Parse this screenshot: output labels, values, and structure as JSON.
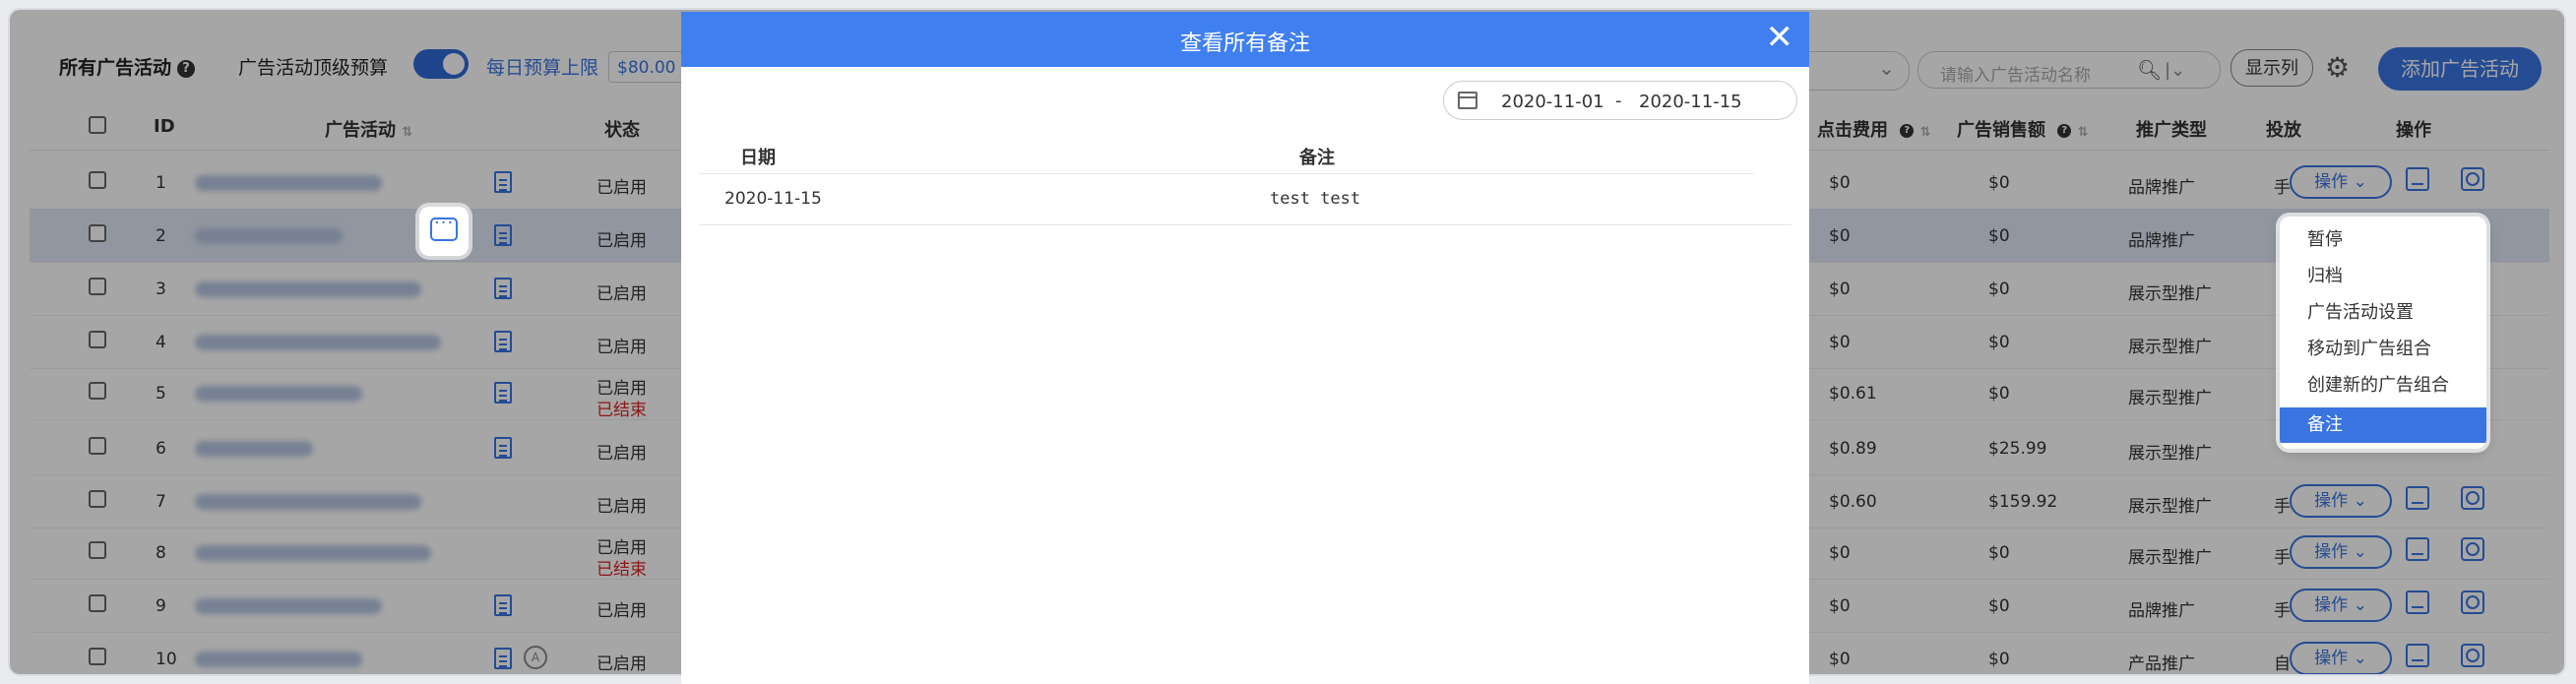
{
  "toolbar": {
    "all_campaigns": "所有广告活动",
    "top_budget_label": "广告活动顶级预算",
    "daily_budget_link": "每日预算上限",
    "budget_value": "$80.00",
    "search_placeholder": "请输入广告活动名称",
    "columns_button": "显示列",
    "add_button": "添加广告活动"
  },
  "table": {
    "headers": {
      "id": "ID",
      "campaign": "广告活动",
      "status": "状态",
      "cpc": "点击费用",
      "sales": "广告销售额",
      "promo_type": "推广类型",
      "delivery": "投放",
      "actions": "操作"
    },
    "rows": [
      {
        "id": "1",
        "status": "已启用",
        "status2": "",
        "cpc": "$0",
        "sales": "$0",
        "type": "品牌推广",
        "delivery": "手",
        "op": "操作"
      },
      {
        "id": "2",
        "status": "已启用",
        "status2": "",
        "cpc": "$0",
        "sales": "$0",
        "type": "品牌推广",
        "delivery": "",
        "op": ""
      },
      {
        "id": "3",
        "status": "已启用",
        "status2": "",
        "cpc": "$0",
        "sales": "$0",
        "type": "展示型推广",
        "delivery": "",
        "op": ""
      },
      {
        "id": "4",
        "status": "已启用",
        "status2": "",
        "cpc": "$0",
        "sales": "$0",
        "type": "展示型推广",
        "delivery": "",
        "op": ""
      },
      {
        "id": "5",
        "status": "已启用",
        "status2": "已结束",
        "cpc": "$0.61",
        "sales": "$0",
        "type": "展示型推广",
        "delivery": "",
        "op": ""
      },
      {
        "id": "6",
        "status": "已启用",
        "status2": "",
        "cpc": "$0.89",
        "sales": "$25.99",
        "type": "展示型推广",
        "delivery": "",
        "op": ""
      },
      {
        "id": "7",
        "status": "已启用",
        "status2": "",
        "cpc": "$0.60",
        "sales": "$159.92",
        "type": "展示型推广",
        "delivery": "手",
        "op": "操作"
      },
      {
        "id": "8",
        "status": "已启用",
        "status2": "已结束",
        "cpc": "$0",
        "sales": "$0",
        "type": "展示型推广",
        "delivery": "手",
        "op": "操作"
      },
      {
        "id": "9",
        "status": "已启用",
        "status2": "",
        "cpc": "$0",
        "sales": "$0",
        "type": "品牌推广",
        "delivery": "手",
        "op": "操作"
      },
      {
        "id": "10",
        "status": "已启用",
        "status2": "",
        "cpc": "$0",
        "sales": "$0",
        "type": "产品推广",
        "delivery": "自",
        "op": "操作"
      }
    ]
  },
  "dropdown": {
    "items": [
      "暂停",
      "归档",
      "广告活动设置",
      "移动到广告组合",
      "创建新的广告组合",
      "备注"
    ]
  },
  "modal": {
    "title": "查看所有备注",
    "date_start": "2020-11-01",
    "date_sep": "-",
    "date_end": "2020-11-15",
    "col_date": "日期",
    "col_note": "备注",
    "rows": [
      {
        "date": "2020-11-15",
        "note": "test test"
      }
    ]
  },
  "colors": {
    "primary": "#3a74e0",
    "modal_header": "#3f7ff0",
    "ended": "#dd2222"
  }
}
